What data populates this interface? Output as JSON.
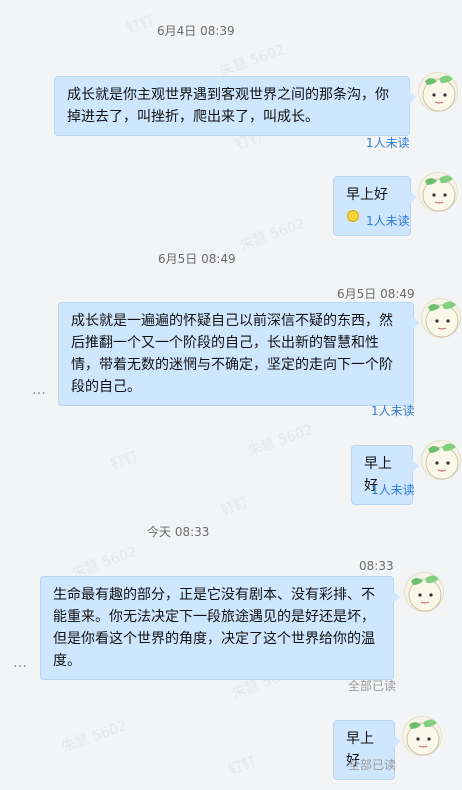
{
  "watermarks": [
    "钉钉",
    "朱慧 5602",
    "钉钉",
    "朱慧 5602",
    "钉钉",
    "朱慧 5602",
    "钉钉",
    "朱慧 5602",
    "钉钉",
    "朱慧 5602",
    "钉钉",
    "朱慧 5602"
  ],
  "timestamps": {
    "t1": "6月4日 08:39",
    "t2": "6月5日 08:49",
    "t3": "6月5日 08:49",
    "t4": "今天 08:33",
    "t5": "08:33"
  },
  "messages": [
    {
      "text": "成长就是你主观世界遇到客观世界之间的那条沟，你掉进去了，叫挫折，爬出来了，叫成长。",
      "status": "1人未读"
    },
    {
      "text": "早上好",
      "emoji": "smile-emoji",
      "status": "1人未读"
    },
    {
      "text": "成长就是一遍遍的怀疑自己以前深信不疑的东西，然后推翻一个又一个阶段的自己，长出新的智慧和性情，带着无数的迷惘与不确定，坚定的走向下一个阶段的自己。",
      "status": "1人未读"
    },
    {
      "text": "早上好",
      "status": "1人未读"
    },
    {
      "text": "生命最有趣的部分，正是它没有剧本、没有彩排、不能重来。你无法决定下一段旅途遇见的是好还是坏，但是你看这个世界的角度，决定了这个世界给你的温度。",
      "status": "全部已读"
    },
    {
      "text": "早上好",
      "status": "全部已读"
    }
  ],
  "more_glyph": "…",
  "colors": {
    "bubble": "#cfe6ff",
    "unread": "#2b7bd6",
    "read_all": "#9a9a9a",
    "background": "#f3f4f6"
  }
}
